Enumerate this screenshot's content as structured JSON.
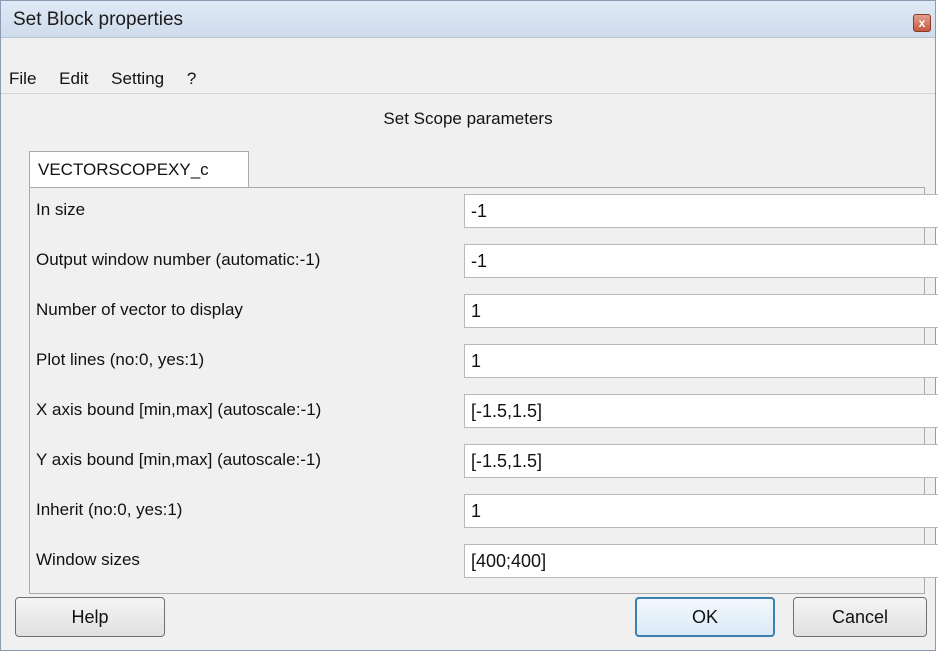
{
  "window": {
    "title": "Set Block properties",
    "close_glyph": "x"
  },
  "menu": {
    "items": [
      {
        "label": "File"
      },
      {
        "label": "Edit"
      },
      {
        "label": "Setting"
      },
      {
        "label": "?"
      }
    ]
  },
  "header": {
    "subtitle": "Set Scope parameters"
  },
  "tab": {
    "label": "VECTORSCOPEXY_c"
  },
  "params": [
    {
      "label": "In size",
      "value": "-1"
    },
    {
      "label": "Output window number (automatic:-1)",
      "value": "-1"
    },
    {
      "label": "Number of vector to display",
      "value": "1"
    },
    {
      "label": "Plot lines (no:0, yes:1)",
      "value": "1"
    },
    {
      "label": "X axis bound [min,max] (autoscale:-1)",
      "value": "[-1.5,1.5]"
    },
    {
      "label": "Y axis bound [min,max] (autoscale:-1)",
      "value": "[-1.5,1.5]"
    },
    {
      "label": "Inherit (no:0, yes:1)",
      "value": "1"
    },
    {
      "label": "Window sizes",
      "value": "[400;400]"
    }
  ],
  "buttons": {
    "help": "Help",
    "ok": "OK",
    "cancel": "Cancel"
  }
}
